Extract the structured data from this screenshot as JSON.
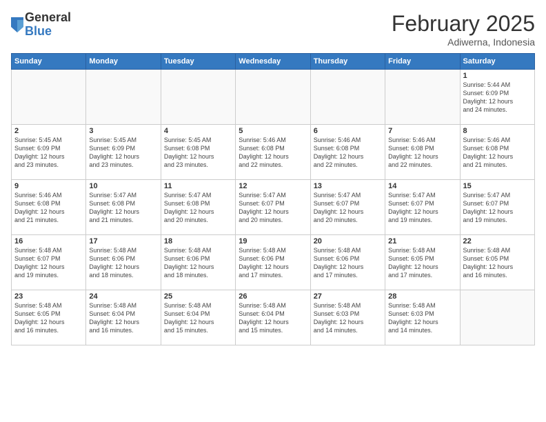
{
  "logo": {
    "general": "General",
    "blue": "Blue"
  },
  "header": {
    "month": "February 2025",
    "location": "Adiwerna, Indonesia"
  },
  "weekdays": [
    "Sunday",
    "Monday",
    "Tuesday",
    "Wednesday",
    "Thursday",
    "Friday",
    "Saturday"
  ],
  "weeks": [
    [
      {
        "day": "",
        "info": ""
      },
      {
        "day": "",
        "info": ""
      },
      {
        "day": "",
        "info": ""
      },
      {
        "day": "",
        "info": ""
      },
      {
        "day": "",
        "info": ""
      },
      {
        "day": "",
        "info": ""
      },
      {
        "day": "1",
        "info": "Sunrise: 5:44 AM\nSunset: 6:09 PM\nDaylight: 12 hours\nand 24 minutes."
      }
    ],
    [
      {
        "day": "2",
        "info": "Sunrise: 5:45 AM\nSunset: 6:09 PM\nDaylight: 12 hours\nand 23 minutes."
      },
      {
        "day": "3",
        "info": "Sunrise: 5:45 AM\nSunset: 6:09 PM\nDaylight: 12 hours\nand 23 minutes."
      },
      {
        "day": "4",
        "info": "Sunrise: 5:45 AM\nSunset: 6:08 PM\nDaylight: 12 hours\nand 23 minutes."
      },
      {
        "day": "5",
        "info": "Sunrise: 5:46 AM\nSunset: 6:08 PM\nDaylight: 12 hours\nand 22 minutes."
      },
      {
        "day": "6",
        "info": "Sunrise: 5:46 AM\nSunset: 6:08 PM\nDaylight: 12 hours\nand 22 minutes."
      },
      {
        "day": "7",
        "info": "Sunrise: 5:46 AM\nSunset: 6:08 PM\nDaylight: 12 hours\nand 22 minutes."
      },
      {
        "day": "8",
        "info": "Sunrise: 5:46 AM\nSunset: 6:08 PM\nDaylight: 12 hours\nand 21 minutes."
      }
    ],
    [
      {
        "day": "9",
        "info": "Sunrise: 5:46 AM\nSunset: 6:08 PM\nDaylight: 12 hours\nand 21 minutes."
      },
      {
        "day": "10",
        "info": "Sunrise: 5:47 AM\nSunset: 6:08 PM\nDaylight: 12 hours\nand 21 minutes."
      },
      {
        "day": "11",
        "info": "Sunrise: 5:47 AM\nSunset: 6:08 PM\nDaylight: 12 hours\nand 20 minutes."
      },
      {
        "day": "12",
        "info": "Sunrise: 5:47 AM\nSunset: 6:07 PM\nDaylight: 12 hours\nand 20 minutes."
      },
      {
        "day": "13",
        "info": "Sunrise: 5:47 AM\nSunset: 6:07 PM\nDaylight: 12 hours\nand 20 minutes."
      },
      {
        "day": "14",
        "info": "Sunrise: 5:47 AM\nSunset: 6:07 PM\nDaylight: 12 hours\nand 19 minutes."
      },
      {
        "day": "15",
        "info": "Sunrise: 5:47 AM\nSunset: 6:07 PM\nDaylight: 12 hours\nand 19 minutes."
      }
    ],
    [
      {
        "day": "16",
        "info": "Sunrise: 5:48 AM\nSunset: 6:07 PM\nDaylight: 12 hours\nand 19 minutes."
      },
      {
        "day": "17",
        "info": "Sunrise: 5:48 AM\nSunset: 6:06 PM\nDaylight: 12 hours\nand 18 minutes."
      },
      {
        "day": "18",
        "info": "Sunrise: 5:48 AM\nSunset: 6:06 PM\nDaylight: 12 hours\nand 18 minutes."
      },
      {
        "day": "19",
        "info": "Sunrise: 5:48 AM\nSunset: 6:06 PM\nDaylight: 12 hours\nand 17 minutes."
      },
      {
        "day": "20",
        "info": "Sunrise: 5:48 AM\nSunset: 6:06 PM\nDaylight: 12 hours\nand 17 minutes."
      },
      {
        "day": "21",
        "info": "Sunrise: 5:48 AM\nSunset: 6:05 PM\nDaylight: 12 hours\nand 17 minutes."
      },
      {
        "day": "22",
        "info": "Sunrise: 5:48 AM\nSunset: 6:05 PM\nDaylight: 12 hours\nand 16 minutes."
      }
    ],
    [
      {
        "day": "23",
        "info": "Sunrise: 5:48 AM\nSunset: 6:05 PM\nDaylight: 12 hours\nand 16 minutes."
      },
      {
        "day": "24",
        "info": "Sunrise: 5:48 AM\nSunset: 6:04 PM\nDaylight: 12 hours\nand 16 minutes."
      },
      {
        "day": "25",
        "info": "Sunrise: 5:48 AM\nSunset: 6:04 PM\nDaylight: 12 hours\nand 15 minutes."
      },
      {
        "day": "26",
        "info": "Sunrise: 5:48 AM\nSunset: 6:04 PM\nDaylight: 12 hours\nand 15 minutes."
      },
      {
        "day": "27",
        "info": "Sunrise: 5:48 AM\nSunset: 6:03 PM\nDaylight: 12 hours\nand 14 minutes."
      },
      {
        "day": "28",
        "info": "Sunrise: 5:48 AM\nSunset: 6:03 PM\nDaylight: 12 hours\nand 14 minutes."
      },
      {
        "day": "",
        "info": ""
      }
    ]
  ]
}
